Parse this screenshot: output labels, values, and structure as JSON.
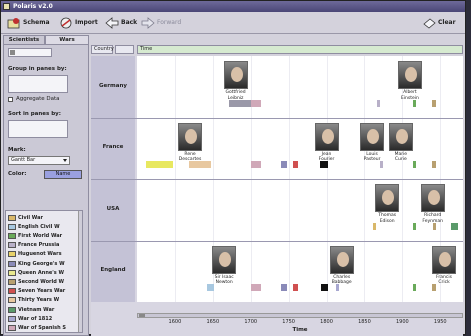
{
  "window": {
    "title": "Polaris v2.0"
  },
  "toolbar": {
    "schema_label": "Schema",
    "import_label": "Import",
    "back_label": "Back",
    "forward_label": "Forward",
    "clear_label": "Clear"
  },
  "tabs": [
    {
      "label": "Scientists"
    },
    {
      "label": "Wars"
    }
  ],
  "sidebar": {
    "group_label": "Group in panes by:",
    "aggregate_label": "Aggregate Data",
    "sort_label": "Sort in panes by:",
    "mark_label": "Mark:",
    "mark_value": "Gantt Bar",
    "color_label": "Color:",
    "color_value": "Name"
  },
  "legend": [
    {
      "label": "Civil War",
      "color": "#d9b86a"
    },
    {
      "label": "English Civil W",
      "color": "#a8c8e0"
    },
    {
      "label": "First World War",
      "color": "#6aaa5a"
    },
    {
      "label": "France Prussia",
      "color": "#b8b0c8"
    },
    {
      "label": "Huguenot Wars",
      "color": "#e8d26a"
    },
    {
      "label": "King George's W",
      "color": "#8a8ab8"
    },
    {
      "label": "Queen Anne's W",
      "color": "#e8e890"
    },
    {
      "label": "Second World W",
      "color": "#b8a070"
    },
    {
      "label": "Seven Years War",
      "color": "#d05050"
    },
    {
      "label": "Thirty Years W",
      "color": "#e8c8a0"
    },
    {
      "label": "Vietnam War",
      "color": "#5a9a6a"
    },
    {
      "label": "War of 1812",
      "color": "#a8a8d0"
    },
    {
      "label": "War of Spanish S",
      "color": "#d0a8b8"
    }
  ],
  "shelves": {
    "rows_label": "Country",
    "cols_label": "Time"
  },
  "rows": [
    {
      "label": "Germany"
    },
    {
      "label": "France"
    },
    {
      "label": "USA"
    },
    {
      "label": "England"
    }
  ],
  "scientists": [
    {
      "name": "Gottfried Leibniz",
      "line1": "Gottfried",
      "line2": "Leibniz",
      "row": 0,
      "year": 1680
    },
    {
      "name": "Albert Einstein",
      "line1": "Albert",
      "line2": "Einstein",
      "row": 0,
      "year": 1910
    },
    {
      "name": "Rene Descartes",
      "line1": "Rene",
      "line2": "Descartes",
      "row": 1,
      "year": 1620
    },
    {
      "name": "Jean Fourier",
      "line1": "Jean",
      "line2": "Fourier",
      "row": 1,
      "year": 1800
    },
    {
      "name": "Louis Pasteur",
      "line1": "Louis",
      "line2": "Pasteur",
      "row": 1,
      "year": 1860
    },
    {
      "name": "Marie Curie",
      "line1": "Marie",
      "line2": "Curie",
      "row": 1,
      "year": 1898
    },
    {
      "name": "Thomas Edison",
      "line1": "Thomas",
      "line2": "Edison",
      "row": 2,
      "year": 1880
    },
    {
      "name": "Richard Feynman",
      "line1": "Richard",
      "line2": "Feynman",
      "row": 2,
      "year": 1940
    },
    {
      "name": "Sir Isaac Newton",
      "line1": "Sir Isaac",
      "line2": "Newton",
      "row": 3,
      "year": 1665
    },
    {
      "name": "Charles Babbage",
      "line1": "Charles",
      "line2": "Babbage",
      "row": 3,
      "year": 1820
    },
    {
      "name": "Francis Crick",
      "line1": "Francis",
      "line2": "Crick",
      "row": 3,
      "year": 1955
    }
  ],
  "wars": [
    {
      "row": 0,
      "start": 1672,
      "end": 1700,
      "color": "#9a98a8"
    },
    {
      "row": 0,
      "start": 1701,
      "end": 1714,
      "color": "#d0a8b8"
    },
    {
      "row": 0,
      "start": 1866,
      "end": 1867,
      "color": "#b8b0c8"
    },
    {
      "row": 0,
      "start": 1914,
      "end": 1918,
      "color": "#6aaa5a"
    },
    {
      "row": 0,
      "start": 1939,
      "end": 1945,
      "color": "#b8a070"
    },
    {
      "row": 1,
      "start": 1562,
      "end": 1598,
      "color": "#e8e860"
    },
    {
      "row": 1,
      "start": 1618,
      "end": 1648,
      "color": "#e8c8a0"
    },
    {
      "row": 1,
      "start": 1701,
      "end": 1714,
      "color": "#d0a8b8"
    },
    {
      "row": 1,
      "start": 1740,
      "end": 1748,
      "color": "#8a8ab8"
    },
    {
      "row": 1,
      "start": 1756,
      "end": 1763,
      "color": "#d05050"
    },
    {
      "row": 1,
      "start": 1792,
      "end": 1802,
      "color": "#111111"
    },
    {
      "row": 1,
      "start": 1870,
      "end": 1871,
      "color": "#b8b0c8"
    },
    {
      "row": 1,
      "start": 1914,
      "end": 1918,
      "color": "#6aaa5a"
    },
    {
      "row": 1,
      "start": 1939,
      "end": 1945,
      "color": "#b8a070"
    },
    {
      "row": 2,
      "start": 1861,
      "end": 1865,
      "color": "#d9b86a"
    },
    {
      "row": 2,
      "start": 1914,
      "end": 1918,
      "color": "#6aaa5a"
    },
    {
      "row": 2,
      "start": 1941,
      "end": 1945,
      "color": "#b8a070"
    },
    {
      "row": 2,
      "start": 1964,
      "end": 1973,
      "color": "#5a9a6a"
    },
    {
      "row": 3,
      "start": 1642,
      "end": 1651,
      "color": "#a8c8e0"
    },
    {
      "row": 3,
      "start": 1701,
      "end": 1714,
      "color": "#d0a8b8"
    },
    {
      "row": 3,
      "start": 1740,
      "end": 1748,
      "color": "#8a8ab8"
    },
    {
      "row": 3,
      "start": 1756,
      "end": 1763,
      "color": "#d05050"
    },
    {
      "row": 3,
      "start": 1793,
      "end": 1802,
      "color": "#111111"
    },
    {
      "row": 3,
      "start": 1812,
      "end": 1815,
      "color": "#a8a8d0"
    },
    {
      "row": 3,
      "start": 1914,
      "end": 1918,
      "color": "#6aaa5a"
    },
    {
      "row": 3,
      "start": 1939,
      "end": 1945,
      "color": "#b8a070"
    }
  ],
  "axis": {
    "title": "Time",
    "min": 1550,
    "max": 1980,
    "ticks": [
      "1600",
      "1650",
      "1700",
      "1750",
      "1800",
      "1850",
      "1900",
      "1950"
    ]
  }
}
